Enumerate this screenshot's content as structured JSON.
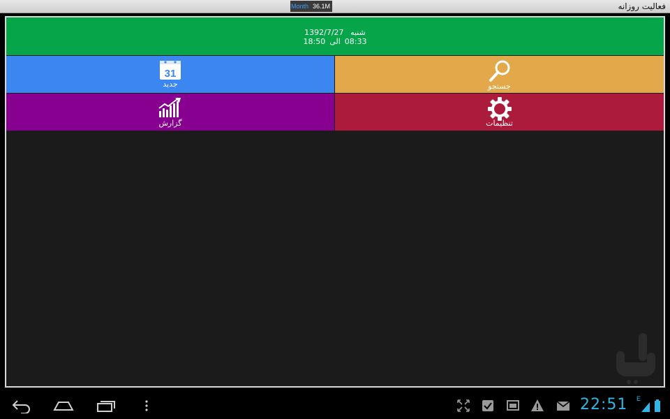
{
  "titlebar": {
    "app_title": "فعالیت روزانه",
    "stats_label": "Month",
    "stats_value": "36.1M"
  },
  "header": {
    "day": "شنبه",
    "date": "1392/7/27",
    "time_from": "08:33",
    "until_word": "الی",
    "time_to": "18:50"
  },
  "tiles": {
    "new": {
      "label": "جدید",
      "icon": "calendar-icon",
      "icon_text": "31",
      "color": "#3b86f0"
    },
    "search": {
      "label": "جستجو",
      "icon": "search-icon",
      "color": "#e2a84a"
    },
    "report": {
      "label": "گزارش",
      "icon": "chart-icon",
      "color": "#88008f"
    },
    "settings": {
      "label": "تنظیمات",
      "icon": "gear-icon",
      "color": "#ad1b3c"
    }
  },
  "navbar": {
    "clock": "22:51",
    "signal_mark": "E",
    "accent": "#33b5e5"
  }
}
